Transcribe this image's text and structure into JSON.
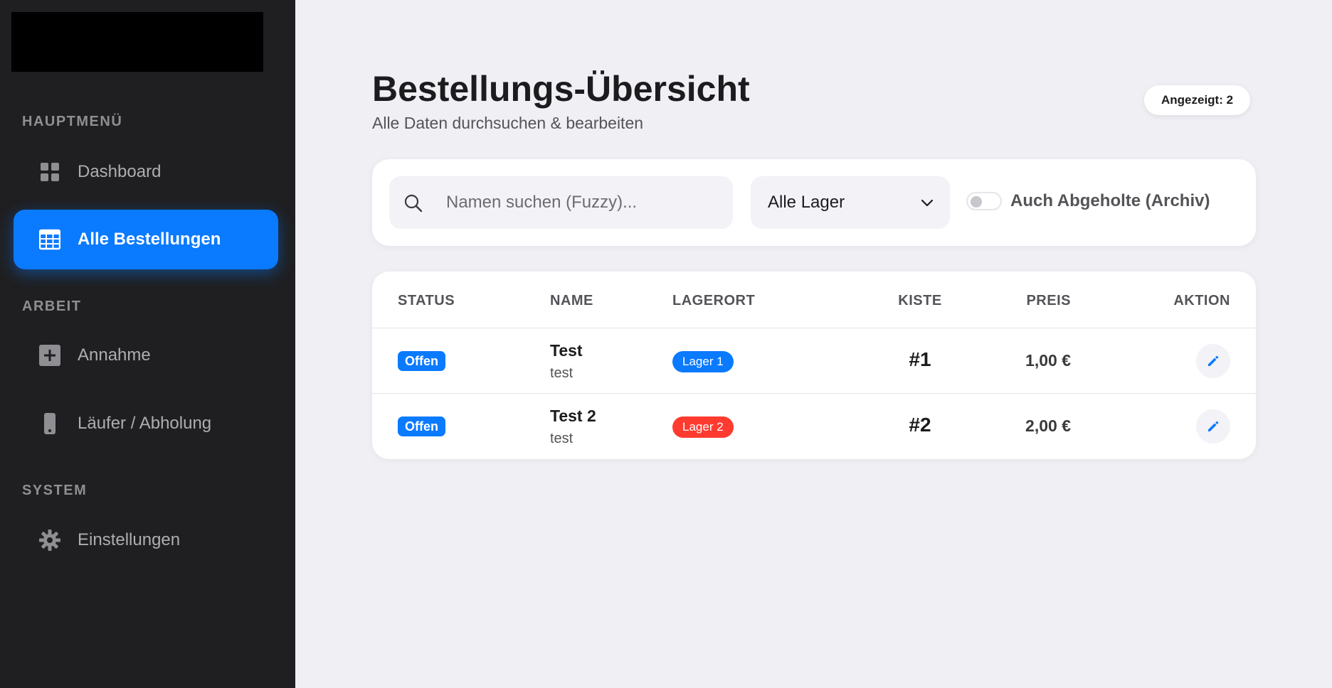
{
  "sidebar": {
    "sections": [
      {
        "title": "HAUPTMENÜ"
      },
      {
        "title": "ARBEIT"
      },
      {
        "title": "SYSTEM"
      }
    ],
    "items": [
      {
        "label": "Dashboard",
        "icon": "dashboard-grid-icon"
      },
      {
        "label": "Alle Bestellungen",
        "icon": "table-icon",
        "active": true
      },
      {
        "label": "Annahme",
        "icon": "plus-square-icon"
      },
      {
        "label": "Läufer / Abholung",
        "icon": "phone-icon"
      },
      {
        "label": "Einstellungen",
        "icon": "gear-icon"
      }
    ]
  },
  "header": {
    "title": "Bestellungs-Übersicht",
    "subtitle": "Alle Daten durchsuchen & bearbeiten",
    "count_badge": "Angezeigt: 2"
  },
  "filters": {
    "search_placeholder": "Namen suchen (Fuzzy)...",
    "search_value": "",
    "lager_select": "Alle Lager",
    "archive_toggle_label": "Auch Abgeholte (Archiv)",
    "archive_toggle_on": false
  },
  "table": {
    "columns": [
      "STATUS",
      "NAME",
      "LAGERORT",
      "KISTE",
      "PREIS",
      "AKTION"
    ],
    "rows": [
      {
        "status": "Offen",
        "name": "Test",
        "sub": "test",
        "lager": "Lager 1",
        "lager_color": "#0a7aff",
        "kiste": "#1",
        "preis": "1,00 €"
      },
      {
        "status": "Offen",
        "name": "Test 2",
        "sub": "test",
        "lager": "Lager 2",
        "lager_color": "#ff3b30",
        "kiste": "#2",
        "preis": "2,00 €"
      }
    ]
  },
  "colors": {
    "accent": "#0a7aff",
    "sidebar_bg": "#1f1f21",
    "page_bg": "#efeff4",
    "danger": "#ff3b30"
  }
}
